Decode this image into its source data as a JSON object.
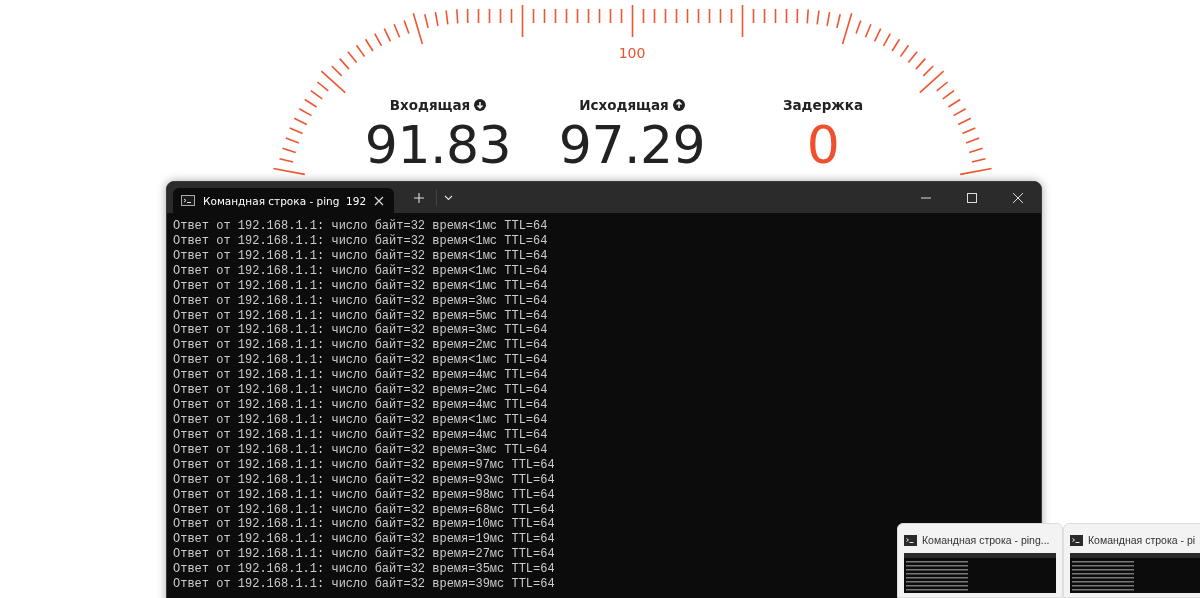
{
  "speedometer": {
    "scale_label": "100",
    "stats": [
      {
        "label": "Входящая",
        "value": "91.83",
        "kind": "download"
      },
      {
        "label": "Исходящая",
        "value": "97.29",
        "kind": "upload"
      },
      {
        "label": "Задержка",
        "value": "0",
        "kind": "latency"
      }
    ]
  },
  "terminal": {
    "tab": {
      "title": "Командная строка - ping  192",
      "selected": true
    },
    "lines": [
      "Ответ от 192.168.1.1: число байт=32 время<1мс TTL=64",
      "Ответ от 192.168.1.1: число байт=32 время<1мс TTL=64",
      "Ответ от 192.168.1.1: число байт=32 время<1мс TTL=64",
      "Ответ от 192.168.1.1: число байт=32 время<1мс TTL=64",
      "Ответ от 192.168.1.1: число байт=32 время<1мс TTL=64",
      "Ответ от 192.168.1.1: число байт=32 время=3мс TTL=64",
      "Ответ от 192.168.1.1: число байт=32 время=5мс TTL=64",
      "Ответ от 192.168.1.1: число байт=32 время=3мс TTL=64",
      "Ответ от 192.168.1.1: число байт=32 время=2мс TTL=64",
      "Ответ от 192.168.1.1: число байт=32 время<1мс TTL=64",
      "Ответ от 192.168.1.1: число байт=32 время=4мс TTL=64",
      "Ответ от 192.168.1.1: число байт=32 время=2мс TTL=64",
      "Ответ от 192.168.1.1: число байт=32 время=4мс TTL=64",
      "Ответ от 192.168.1.1: число байт=32 время<1мс TTL=64",
      "Ответ от 192.168.1.1: число байт=32 время=4мс TTL=64",
      "Ответ от 192.168.1.1: число байт=32 время=3мс TTL=64",
      "Ответ от 192.168.1.1: число байт=32 время=97мс TTL=64",
      "Ответ от 192.168.1.1: число байт=32 время=93мс TTL=64",
      "Ответ от 192.168.1.1: число байт=32 время=98мс TTL=64",
      "Ответ от 192.168.1.1: число байт=32 время=68мс TTL=64",
      "Ответ от 192.168.1.1: число байт=32 время=10мс TTL=64",
      "Ответ от 192.168.1.1: число байт=32 время=19мс TTL=64",
      "Ответ от 192.168.1.1: число байт=32 время=27мс TTL=64",
      "Ответ от 192.168.1.1: число байт=32 время=35мс TTL=64",
      "Ответ от 192.168.1.1: число байт=32 время=39мс TTL=64"
    ]
  },
  "taskbar_previews": [
    {
      "title": "Командная строка - ping..."
    },
    {
      "title": "Командная строка - pi"
    }
  ]
}
